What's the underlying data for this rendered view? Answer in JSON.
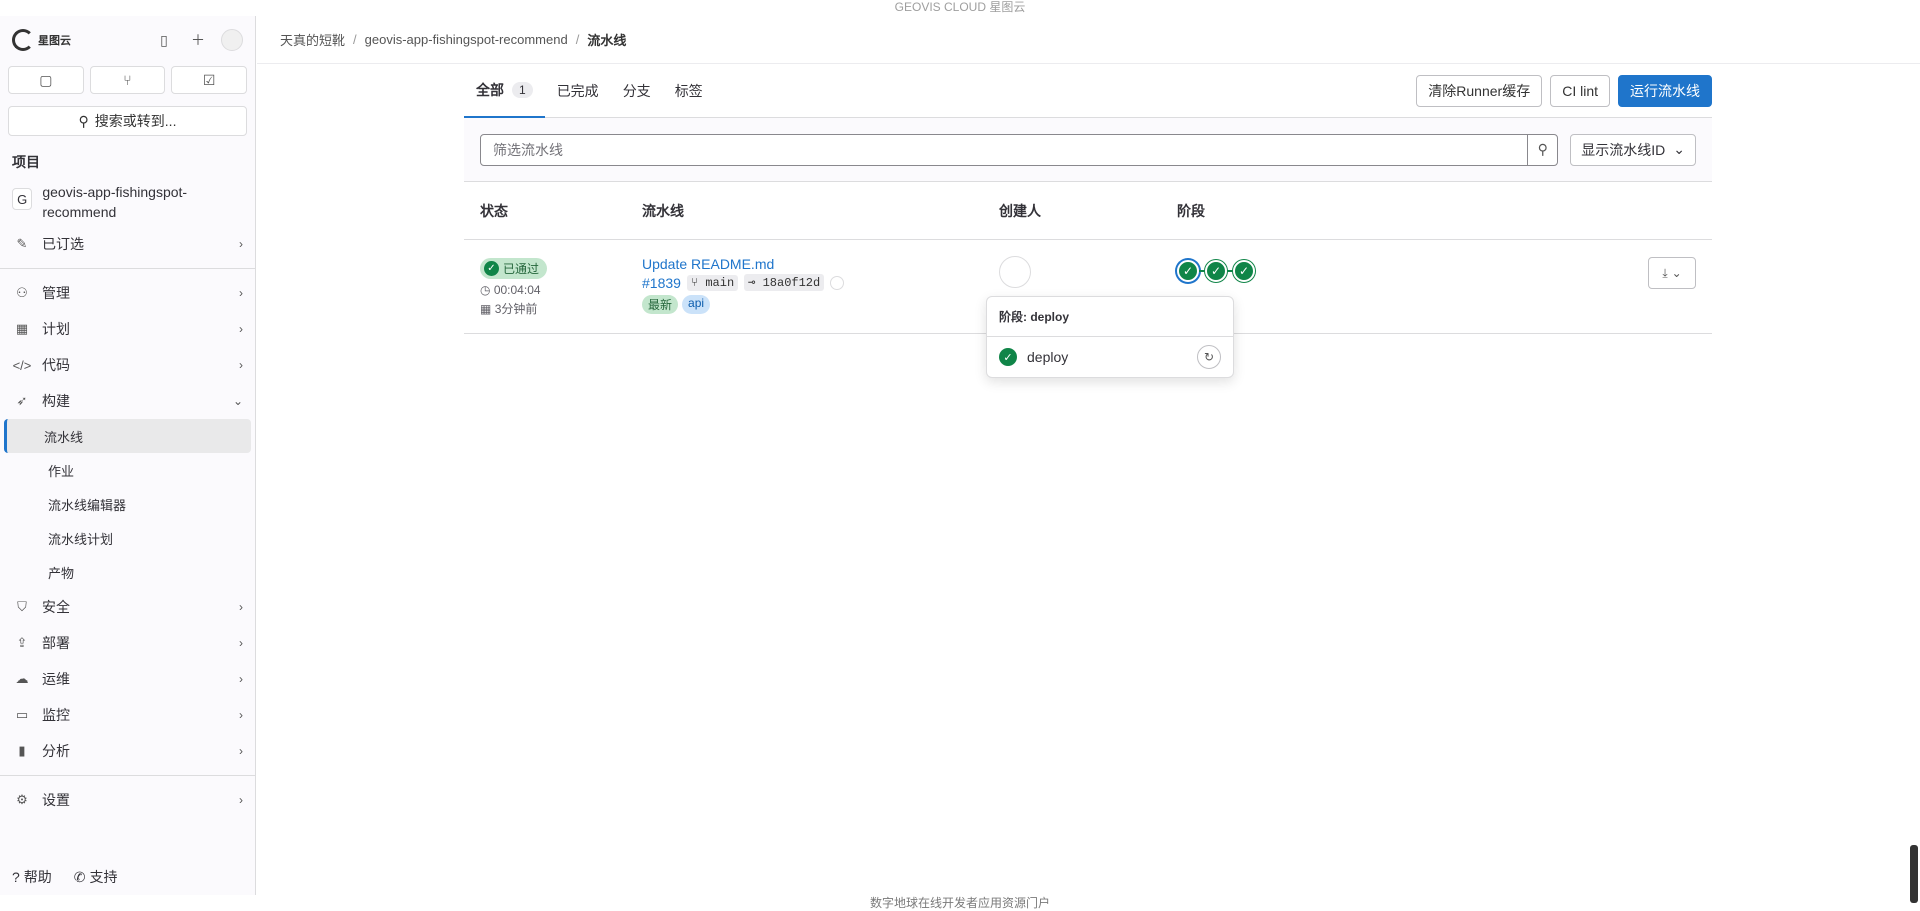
{
  "topbar": {
    "title": "GEOVIS CLOUD 星图云"
  },
  "footer": {
    "text": "数字地球在线开发者应用资源门户"
  },
  "sidebar": {
    "logo_text": "星图云",
    "search_label": "搜索或转到...",
    "section_title": "项目",
    "project": {
      "avatar": "G",
      "name": "geovis-app-fishingspot-recommend"
    },
    "nav": {
      "pinned": "已订选",
      "manage": "管理",
      "plan": "计划",
      "code": "代码",
      "build": "构建",
      "security": "安全",
      "deploy": "部署",
      "ops": "运维",
      "monitor": "监控",
      "analytics": "分析",
      "settings": "设置"
    },
    "build_sub": {
      "pipelines": "流水线",
      "jobs": "作业",
      "editor": "流水线编辑器",
      "schedules": "流水线计划",
      "artifacts": "产物"
    },
    "help": "帮助",
    "support": "支持"
  },
  "breadcrumb": {
    "group": "天真的短靴",
    "project": "geovis-app-fishingspot-recommend",
    "current": "流水线"
  },
  "tabs": {
    "all": "全部",
    "all_count": "1",
    "finished": "已完成",
    "branches": "分支",
    "tags": "标签"
  },
  "actions": {
    "clear_cache": "清除Runner缓存",
    "ci_lint": "CI lint",
    "run": "运行流水线"
  },
  "filter": {
    "placeholder": "筛选流水线",
    "display_select": "显示流水线ID"
  },
  "table": {
    "headers": {
      "status": "状态",
      "pipeline": "流水线",
      "creator": "创建人",
      "stages": "阶段"
    },
    "row": {
      "status": "已通过",
      "duration": "00:04:04",
      "finished": "3分钟前",
      "title": "Update README.md",
      "id": "#1839",
      "branch": "main",
      "commit": "18a0f12d",
      "tag_latest": "最新",
      "tag_api": "api"
    }
  },
  "popover": {
    "title": "阶段: deploy",
    "job": "deploy"
  },
  "colors": {
    "primary": "#1f75cb",
    "success": "#108548"
  }
}
